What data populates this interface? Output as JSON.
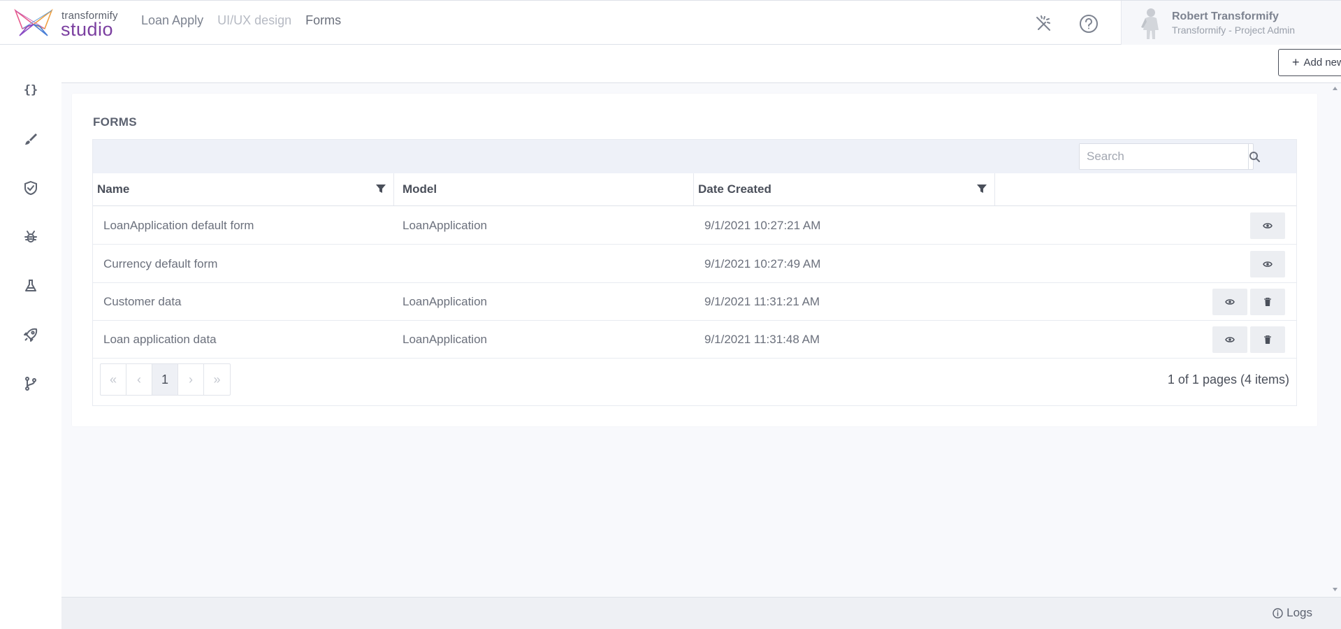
{
  "brand": {
    "small": "transformify",
    "big": "studio"
  },
  "breadcrumbs": [
    {
      "label": "Loan Apply"
    },
    {
      "label": "UI/UX design"
    },
    {
      "label": "Forms"
    }
  ],
  "user": {
    "name": "Robert Transformify",
    "role": "Transformify - Project Admin"
  },
  "sidebar": {
    "items": [
      {
        "icon": "braces-icon",
        "glyph": "{}"
      },
      {
        "icon": "brush-icon"
      },
      {
        "icon": "shield-check-icon"
      },
      {
        "icon": "bug-icon"
      },
      {
        "icon": "flask-icon"
      },
      {
        "icon": "rocket-icon"
      },
      {
        "icon": "git-branch-icon"
      }
    ]
  },
  "subheader": {
    "add_label": "Add new form",
    "add_glyph": "+"
  },
  "forms": {
    "title": "FORMS",
    "search_placeholder": "Search",
    "columns": [
      "Name",
      "Model",
      "Date Created"
    ],
    "rows": [
      {
        "name": "LoanApplication default form",
        "model": "LoanApplication",
        "date": "9/1/2021 10:27:21 AM",
        "deletable": false
      },
      {
        "name": "Currency default form",
        "model": "",
        "date": "9/1/2021 10:27:49 AM",
        "deletable": false
      },
      {
        "name": "Customer data",
        "model": "LoanApplication",
        "date": "9/1/2021 11:31:21 AM",
        "deletable": true
      },
      {
        "name": "Loan application data",
        "model": "LoanApplication",
        "date": "9/1/2021 11:31:48 AM",
        "deletable": true
      }
    ],
    "pager": {
      "first": "«",
      "prev": "‹",
      "current": "1",
      "next": "›",
      "last": "»"
    },
    "page_info": "1 of 1 pages (4 items)"
  },
  "footer": {
    "logs_label": "Logs"
  },
  "colors": {
    "brand_purple": "#7b3fa0",
    "text": "#4a4f5a",
    "toolbar_bg": "#eef1f8"
  }
}
